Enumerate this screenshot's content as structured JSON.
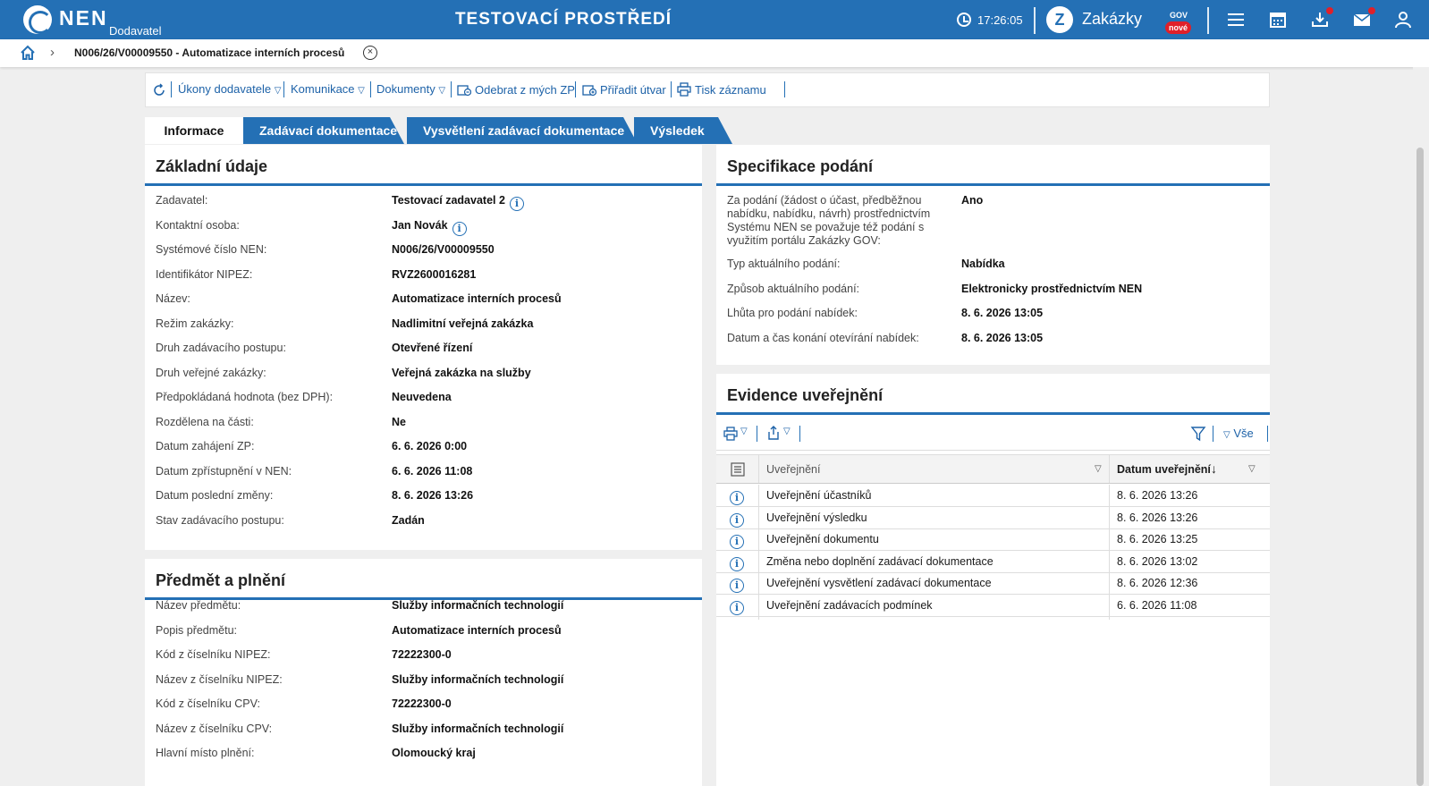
{
  "topbar": {
    "logo_text": "NEN",
    "logo_sub": "Dodavatel",
    "env_title": "TESTOVACÍ PROSTŘEDÍ",
    "time": "17:26:05",
    "portal_name": "Zakázky",
    "portal_sup": "GOV",
    "portal_badge": "nové",
    "icons": [
      "menu-icon",
      "calendar-icon",
      "download-icon",
      "mail-icon",
      "user-icon"
    ],
    "accent": "#2470b5",
    "badge_color": "#e0202a"
  },
  "breadcrumb": {
    "title": "N006/26/V00009550 - Automatizace interních procesů"
  },
  "toolbar": {
    "refresh_icon": "refresh-icon",
    "ukony": "Úkony dodavatele",
    "komunikace": "Komunikace",
    "dokumenty": "Dokumenty",
    "odebrat": "Odebrat z mých ZP",
    "priradit": "Přiřadit útvar",
    "tisk": "Tisk záznamu"
  },
  "tabs": [
    "Informace",
    "Zadávací dokumentace",
    "Vysvětlení zadávací dokumentace",
    "Výsledek"
  ],
  "zakladni": {
    "title": "Základní údaje",
    "rows": [
      {
        "label": "Zadavatel:",
        "value": "Testovací zadavatel 2"
      },
      {
        "label": "Kontaktní osoba:",
        "value": "Jan Novák"
      },
      {
        "label": "Systémové číslo NEN:",
        "value": "N006/26/V00009550"
      },
      {
        "label": "Identifikátor NIPEZ:",
        "value": "RVZ2600016281"
      },
      {
        "label": "Název:",
        "value": "Automatizace interních procesů"
      },
      {
        "label": "Režim zakázky:",
        "value": "Nadlimitní veřejná zakázka"
      },
      {
        "label": "Druh zadávacího postupu:",
        "value": "Otevřené řízení"
      },
      {
        "label": "Druh veřejné zakázky:",
        "value": "Veřejná zakázka na služby"
      },
      {
        "label": "Předpokládaná hodnota (bez DPH):",
        "value": "Neuvedena"
      },
      {
        "label": "Rozdělena na části:",
        "value": "Ne"
      },
      {
        "label": "Datum zahájení ZP:",
        "value": "6. 6. 2026 0:00"
      },
      {
        "label": "Datum zpřístupnění v NEN:",
        "value": "6. 6. 2026 11:08"
      },
      {
        "label": "Datum poslední změny:",
        "value": "8. 6. 2026 13:26"
      },
      {
        "label": "Stav zadávacího postupu:",
        "value": "Zadán"
      }
    ]
  },
  "predmet": {
    "title": "Předmět a plnění",
    "rows": [
      {
        "label": "Název předmětu:",
        "value": "Služby informačních technologií"
      },
      {
        "label": "Popis předmětu:",
        "value": "Automatizace interních procesů"
      },
      {
        "label": "Kód z číselníku NIPEZ:",
        "value": "72222300-0"
      },
      {
        "label": "Název z číselníku NIPEZ:",
        "value": "Služby informačních technologií"
      },
      {
        "label": "Kód z číselníku CPV:",
        "value": "72222300-0"
      },
      {
        "label": "Název z číselníku CPV:",
        "value": "Služby informačních technologií"
      },
      {
        "label": "Hlavní místo plnění:",
        "value": "Olomoucký kraj"
      }
    ]
  },
  "specifikace": {
    "title": "Specifikace podání",
    "rows": [
      {
        "label": "Za podání (žádost o účast, předběžnou nabídku, nabídku, návrh) prostřednictvím Systému NEN se považuje též podání s využitím portálu Zakázky GOV:",
        "value": "Ano"
      },
      {
        "label": "Typ aktuálního podání:",
        "value": "Nabídka"
      },
      {
        "label": "Způsob aktuálního podání:",
        "value": "Elektronicky prostřednictvím NEN"
      },
      {
        "label": "Lhůta pro podání nabídek:",
        "value": "8. 6. 2026 13:05"
      },
      {
        "label": "Datum a čas konání otevírání nabídek:",
        "value": "8. 6. 2026 13:05"
      }
    ]
  },
  "evidence": {
    "title": "Evidence uveřejnění",
    "filter_all": "Vše",
    "col_name": "Uveřejnění",
    "col_date": "Datum uveřejnění",
    "rows": [
      {
        "name": "Uveřejnění účastníků",
        "date": "8. 6. 2026 13:26"
      },
      {
        "name": "Uveřejnění výsledku",
        "date": "8. 6. 2026 13:26"
      },
      {
        "name": "Uveřejnění dokumentu",
        "date": "8. 6. 2026 13:25"
      },
      {
        "name": "Změna nebo doplnění zadávací dokumentace",
        "date": "8. 6. 2026 13:02"
      },
      {
        "name": "Uveřejnění vysvětlení zadávací dokumentace",
        "date": "8. 6. 2026 12:36"
      },
      {
        "name": "Uveřejnění zadávacích podmínek",
        "date": "6. 6. 2026 11:08"
      }
    ]
  }
}
